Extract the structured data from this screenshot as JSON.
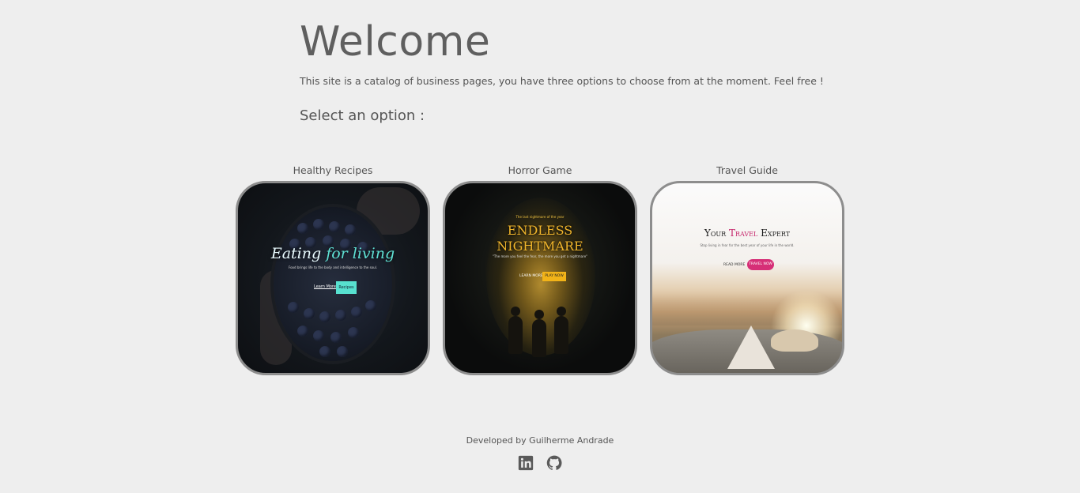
{
  "header": {
    "title": "Welcome",
    "intro": "This site is a catalog of business pages, you have three options to choose from at the moment. Feel free !",
    "select_label": "Select an option :"
  },
  "options": [
    {
      "label": "Healthy Recipes",
      "preview": {
        "title_main": "Eating",
        "title_accent": "for living",
        "subtitle": "Food brings life to the body and intelligence to the soul.",
        "link": "Learn More",
        "button": "Recipes"
      }
    },
    {
      "label": "Horror Game",
      "preview": {
        "kicker": "The last nightmare of the year",
        "title_line1": "ENDLESS",
        "title_line2": "NIGHTMARE",
        "subtitle": "\"The more you feel the fear, the more you get a nightmare\"",
        "link": "LEARN MORE",
        "button": "PLAY NOW"
      }
    },
    {
      "label": "Travel Guide",
      "preview": {
        "title_a": "Your",
        "title_accent": "Travel",
        "title_b": "Expert",
        "subtitle": "Stop living in fear for the best year of your life in the world.",
        "link": "READ MORE",
        "button": "TRAVEL NOW"
      }
    }
  ],
  "footer": {
    "credit": "Developed by Guilherme Andrade",
    "icons": [
      "linkedin-icon",
      "github-icon"
    ],
    "icon_color": "#5a5a5a"
  },
  "colors": {
    "background": "#eeeeee",
    "card_border": "#8d8d8d",
    "text": "#555555"
  }
}
